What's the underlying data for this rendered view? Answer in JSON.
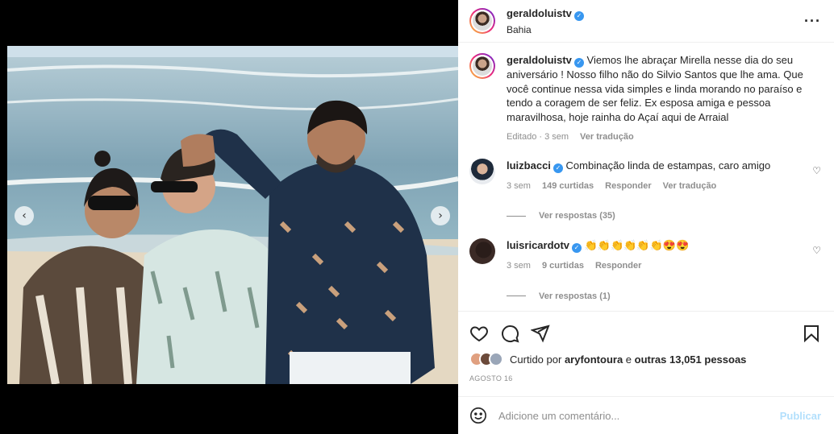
{
  "post": {
    "username": "geraldoluistv",
    "location": "Bahia",
    "more_icon": "more-horizontal-icon"
  },
  "caption": {
    "username": "geraldoluistv",
    "text": "Viemos lhe abraçar Mirella nesse dia do seu aniversário ! Nosso filho não do Silvio Santos que lhe ama. Que você continue nessa vida simples e linda morando no paraíso e tendo a coragem de ser feliz. Ex esposa amiga e pessoa maravilhosa, hoje rainha do Açaí aqui de Arraial",
    "edited": "Editado · 3 sem",
    "translate": "Ver tradução"
  },
  "comments": [
    {
      "username": "luizbacci",
      "text": "Combinação linda de estampas, caro amigo",
      "time": "3 sem",
      "likes": "149 curtidas",
      "reply": "Responder",
      "translate": "Ver tradução",
      "view_replies": "Ver respostas (35)"
    },
    {
      "username": "luisricardotv",
      "text": "👏👏👏👏👏👏😍😍",
      "time": "3 sem",
      "likes": "9 curtidas",
      "reply": "Responder",
      "view_replies": "Ver respostas (1)"
    }
  ],
  "likes": {
    "prefix": "Curtido por",
    "user": "aryfontoura",
    "conjunction": "e",
    "others": "outras 13,051 pessoas"
  },
  "date": "AGOSTO 16",
  "add_comment": {
    "placeholder": "Adicione um comentário...",
    "publish": "Publicar"
  },
  "colors": {
    "verified": "#3897f0",
    "publish_disabled": "#b2dffc",
    "muted": "#8e8e8e"
  }
}
